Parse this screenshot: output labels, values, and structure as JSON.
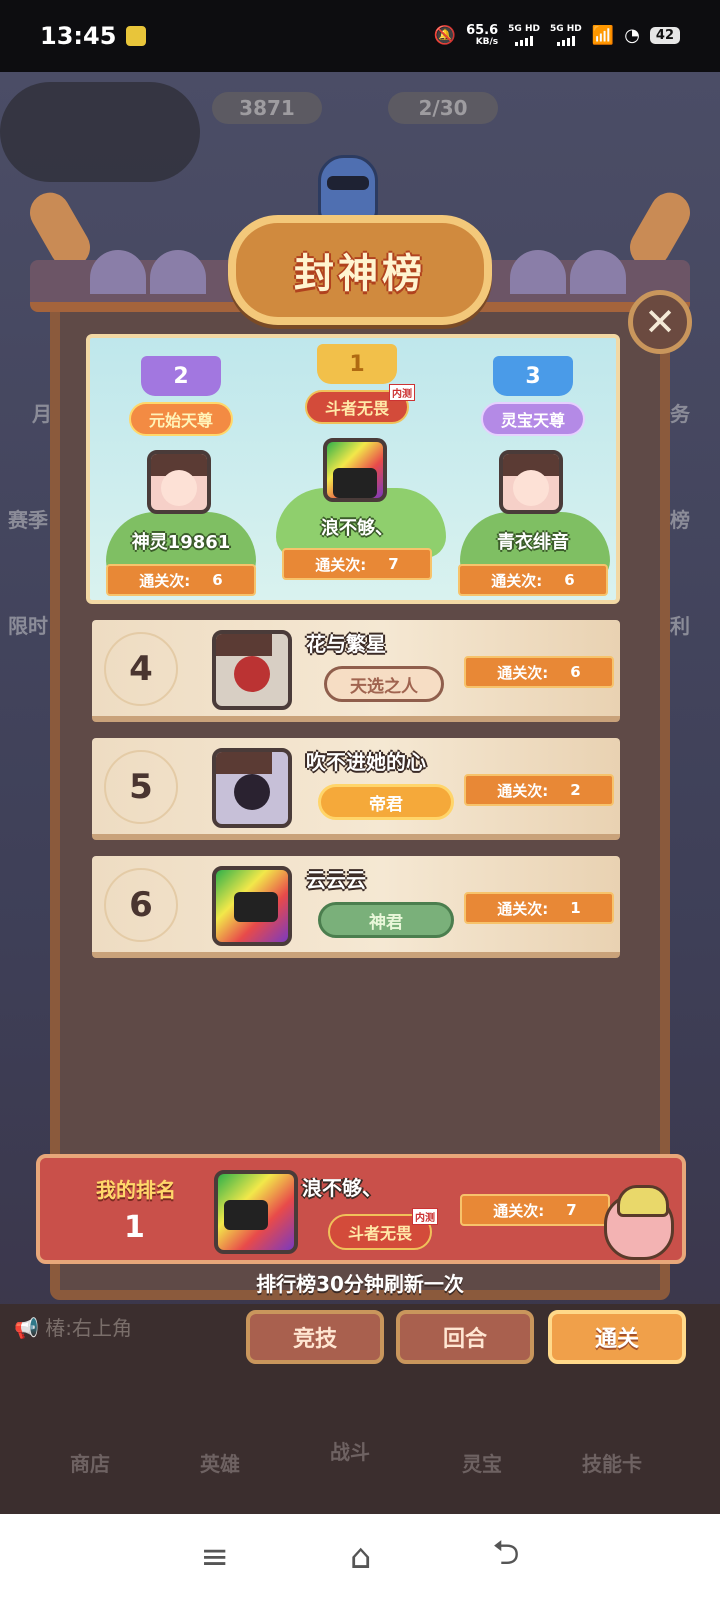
{
  "status_bar": {
    "time": "13:45",
    "net_speed": "65.6",
    "net_unit": "KB/s",
    "sim1": "5G HD",
    "sim2": "5G HD",
    "battery": "42"
  },
  "background": {
    "resource_1": "3871",
    "resource_2": "2/30",
    "side_left": [
      "月",
      "赛季",
      "限时"
    ],
    "side_right": [
      "任务",
      "行榜",
      "福利"
    ],
    "notice": "椿:右上角",
    "tabs": [
      "商店",
      "英雄",
      "战斗",
      "灵宝",
      "技能卡"
    ]
  },
  "board": {
    "title": "封神榜",
    "close_icon": "close-x-icon"
  },
  "podium": [
    {
      "rank": "2",
      "title": "元始天尊",
      "name": "神灵19861",
      "clear_label": "通关次:",
      "clear_count": "6",
      "crown_color": "#a277e0",
      "avatar": "girl"
    },
    {
      "rank": "1",
      "title": "斗者无畏",
      "tag": "内测",
      "name": "浪不够、",
      "clear_label": "通关次:",
      "clear_count": "7",
      "crown_color": "#f2c04a",
      "avatar": "parrot"
    },
    {
      "rank": "3",
      "title": "灵宝天尊",
      "name": "青衣绯音",
      "clear_label": "通关次:",
      "clear_count": "6",
      "crown_color": "#4a9be8",
      "avatar": "girl"
    }
  ],
  "rows": [
    {
      "rank": "4",
      "name": "花与繁星",
      "badge": "天选之人",
      "badge_style": "brown",
      "clear_label": "通关次:",
      "clear_count": "6",
      "avatar": "demon"
    },
    {
      "rank": "5",
      "name": "吹不进她的心",
      "badge": "帝君",
      "badge_style": "gold",
      "clear_label": "通关次:",
      "clear_count": "2",
      "avatar": "dark"
    },
    {
      "rank": "6",
      "name": "云云云",
      "badge": "神君",
      "badge_style": "green",
      "clear_label": "通关次:",
      "clear_count": "1",
      "avatar": "parrot"
    }
  ],
  "my_rank": {
    "label": "我的排名",
    "rank": "1",
    "name": "浪不够、",
    "title": "斗者无畏",
    "tag": "内测",
    "clear_label": "通关次:",
    "clear_count": "7"
  },
  "refresh_note": "排行榜30分钟刷新一次",
  "mode_tabs": [
    {
      "label": "竞技",
      "active": false
    },
    {
      "label": "回合",
      "active": false
    },
    {
      "label": "通关",
      "active": true
    }
  ],
  "navbar": {
    "menu_icon": "≡",
    "home_icon": "⌂",
    "back_icon": "⮌"
  }
}
